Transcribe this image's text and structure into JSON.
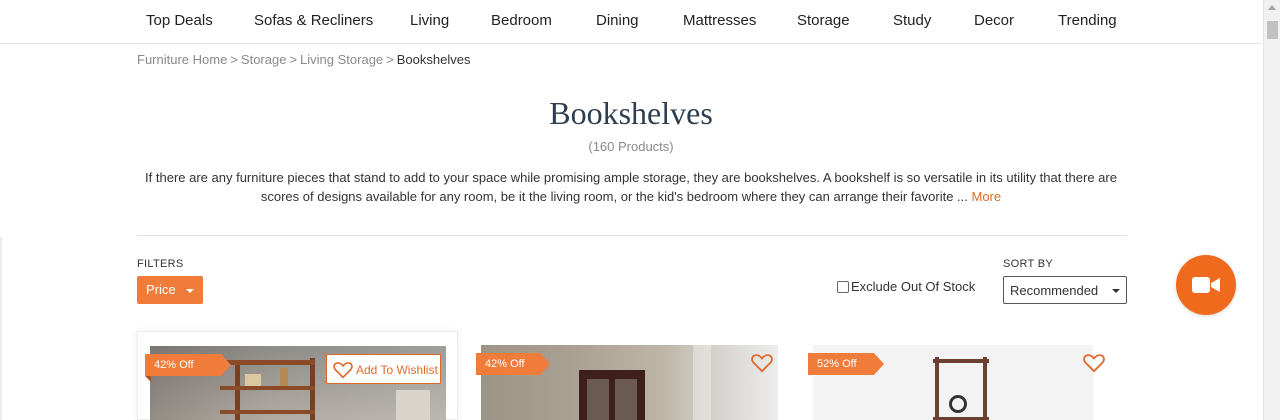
{
  "nav": {
    "items": [
      "Top Deals",
      "Sofas & Recliners",
      "Living",
      "Bedroom",
      "Dining",
      "Mattresses",
      "Storage",
      "Study",
      "Decor",
      "Trending"
    ]
  },
  "breadcrumb": {
    "items": [
      "Furniture Home",
      "Storage",
      "Living Storage"
    ],
    "separator": ">",
    "current": "Bookshelves"
  },
  "page": {
    "title": "Bookshelves",
    "count": "(160 Products)",
    "description": "If there are any furniture pieces that stand to add to your space while promising ample storage, they are bookshelves. A bookshelf is so versatile in its utility that there are scores of designs available for any room, be it the living room, or the kid's bedroom where they can arrange their favorite ... ",
    "more_label": "More"
  },
  "filters": {
    "label": "FILTERS",
    "price_label": "Price",
    "exclude_label": "Exclude Out Of Stock",
    "exclude_checked": false
  },
  "sort": {
    "label": "SORT BY",
    "value": "Recommended"
  },
  "products": [
    {
      "badge": "42% Off",
      "wishlist_label": "Add To Wishlist"
    },
    {
      "badge": "42% Off"
    },
    {
      "badge": "52% Off"
    }
  ],
  "colors": {
    "accent": "#f07c3c",
    "fab": "#f06a1e",
    "title": "#2c3e50"
  },
  "icons": {
    "video": "video-camera-icon",
    "heart": "heart-outline-icon",
    "caret": "caret-down-icon"
  }
}
